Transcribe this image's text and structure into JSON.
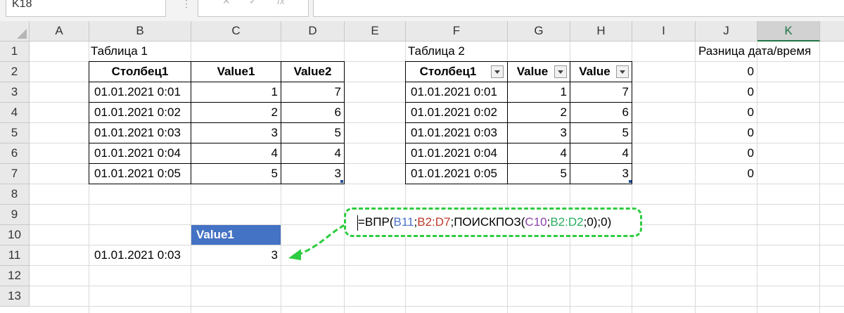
{
  "namebox": {
    "value": "K18"
  },
  "toolbar": {
    "cancel": "✕",
    "confirm": "✓",
    "fx": "fx"
  },
  "columns": [
    "A",
    "B",
    "C",
    "D",
    "E",
    "F",
    "G",
    "H",
    "I",
    "J",
    "K"
  ],
  "rows": [
    "1",
    "2",
    "3",
    "4",
    "5",
    "6",
    "7",
    "8",
    "9",
    "10",
    "11",
    "12",
    "13"
  ],
  "table1": {
    "caption": "Таблица 1",
    "headers": [
      "Столбец1",
      "Value1",
      "Value2"
    ],
    "rows": [
      [
        "01.01.2021 0:01",
        "1",
        "7"
      ],
      [
        "01.01.2021 0:02",
        "2",
        "6"
      ],
      [
        "01.01.2021 0:03",
        "3",
        "5"
      ],
      [
        "01.01.2021 0:04",
        "4",
        "4"
      ],
      [
        "01.01.2021 0:05",
        "5",
        "3"
      ]
    ]
  },
  "table2": {
    "caption": "Таблица 2",
    "headers": [
      "Столбец1",
      "Value",
      "Value"
    ],
    "rows": [
      [
        "01.01.2021 0:01",
        "1",
        "7"
      ],
      [
        "01.01.2021 0:02",
        "2",
        "6"
      ],
      [
        "01.01.2021 0:03",
        "3",
        "5"
      ],
      [
        "01.01.2021 0:04",
        "4",
        "4"
      ],
      [
        "01.01.2021 0:05",
        "5",
        "3"
      ]
    ]
  },
  "diff": {
    "caption": "Разница дата/время",
    "values": [
      "0",
      "0",
      "0",
      "0",
      "0",
      "0"
    ]
  },
  "lookup": {
    "header": "Value1",
    "key": "01.01.2021 0:03",
    "result": "3"
  },
  "formula": {
    "parts": [
      "=ВПР(",
      "B11",
      ";",
      "B2:D7",
      ";ПОИСКПОЗ(",
      "C10",
      ";",
      "B2:D2",
      ";0);0)"
    ]
  },
  "colors": {
    "green_dash": "#2ecc40",
    "table_header_blue": "#4472c4",
    "selected_col_header": "#217346"
  }
}
